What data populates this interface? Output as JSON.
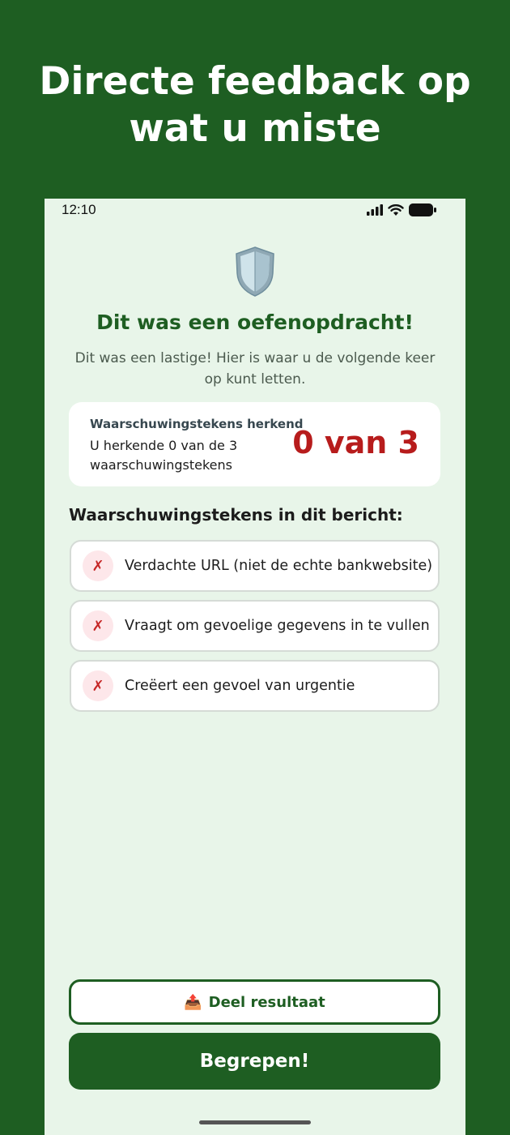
{
  "headline": {
    "line1": "Directe feedback op",
    "line2": "wat u miste"
  },
  "status_bar": {
    "time": "12:10",
    "icons": [
      "signal-icon",
      "wifi-icon",
      "battery-icon"
    ]
  },
  "result": {
    "icon": "shield-icon",
    "title": "Dit was een oefenopdracht!",
    "subtitle": "Dit was een lastige! Hier is waar u de volgende keer op kunt letten."
  },
  "score_card": {
    "label": "Waarschuwingstekens herkend",
    "description": "U herkende 0 van de 3 waarschuwingstekens",
    "value": "0 van 3"
  },
  "signs": {
    "title": "Waarschuwingstekens in dit bericht:",
    "items": [
      {
        "icon": "✗",
        "text": "Verdachte URL (niet de echte bankwebsite)"
      },
      {
        "icon": "✗",
        "text": "Vraagt om gevoelige gegevens in te vullen"
      },
      {
        "icon": "✗",
        "text": "Creëert een gevoel van urgentie"
      }
    ]
  },
  "actions": {
    "share_icon": "📤",
    "share_label": "Deel resultaat",
    "confirm_label": "Begrepen!"
  },
  "colors": {
    "brand_green": "#1e5e22",
    "background_light": "#e8f5e9",
    "error_red": "#b71c1c"
  }
}
